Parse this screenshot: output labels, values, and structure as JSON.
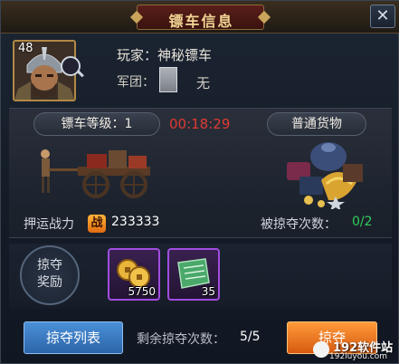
{
  "window": {
    "title": "镖车信息",
    "close_glyph": "✕"
  },
  "player": {
    "level": "48",
    "name_line": "玩家：神秘镖车",
    "guild_label": "军团：",
    "guild_value": "无"
  },
  "cart": {
    "level_label": "镖车等级：1",
    "timer": "00:18:29",
    "goods_type": "普通货物",
    "escort_power_label": "押运战力",
    "power_badge": "战",
    "escort_power_value": "233333",
    "robbed_label": "被掠夺次数：",
    "robbed_value": "0/2"
  },
  "rewards": {
    "label_line1": "掠夺",
    "label_line2": "奖励",
    "items": [
      {
        "icon": "gold-coins-icon",
        "count": "5750"
      },
      {
        "icon": "green-scroll-icon",
        "count": "35"
      }
    ]
  },
  "footer": {
    "rob_list_label": "掠夺列表",
    "remaining_label": "剩余掠夺次数：",
    "remaining_value": "5/5",
    "rob_label": "掠夺"
  },
  "watermark": {
    "line1": "192软件站",
    "line2": "192luyou.com"
  },
  "colors": {
    "title_gold": "#f3d694",
    "timer_red": "#e03a32",
    "count_green": "#2fcf5a",
    "button_blue": "#2d64a8",
    "button_orange": "#d65a10",
    "item_border_purple": "#a04de0"
  }
}
